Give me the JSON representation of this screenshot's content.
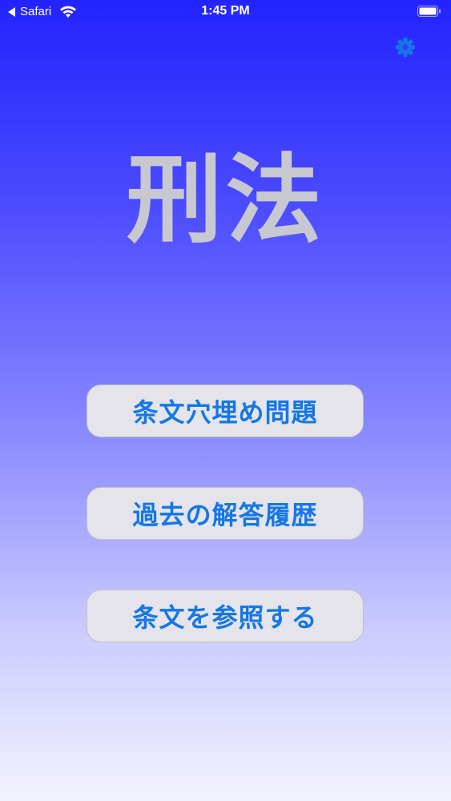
{
  "status_bar": {
    "back_app": "Safari",
    "time": "1:45 PM"
  },
  "header": {
    "settings_icon": "gear-icon"
  },
  "main": {
    "title": "刑法",
    "buttons": [
      {
        "label": "条文穴埋め問題"
      },
      {
        "label": "過去の解答履歴"
      },
      {
        "label": "条文を参照する"
      }
    ]
  },
  "colors": {
    "gradient_top": "#2323ff",
    "gradient_bottom": "#f3f3ff",
    "button_text": "#1477e6",
    "button_bg": "#e4e4ea",
    "title": "#c8c8d0",
    "gear": "#1477e6"
  }
}
